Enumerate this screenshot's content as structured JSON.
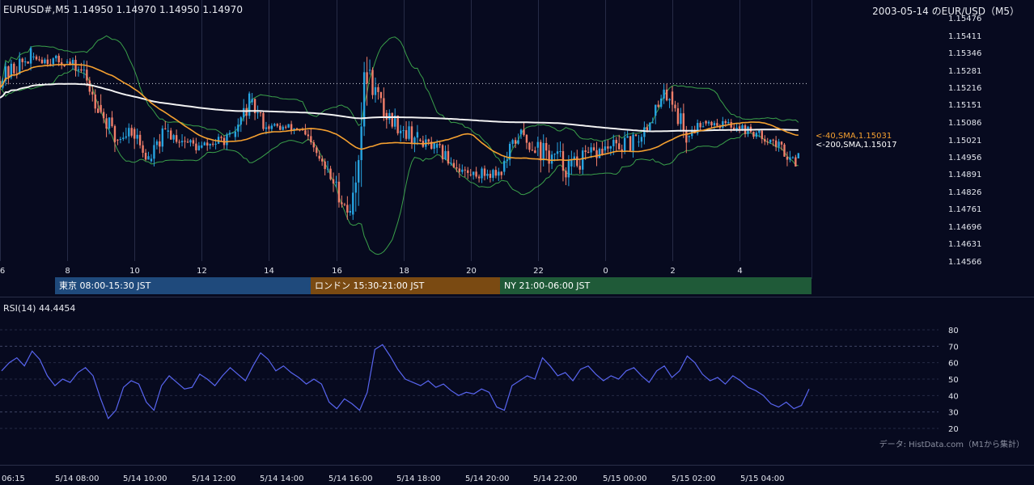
{
  "header": {
    "ohlc_text": "EURUSD#,M5 1.14950 1.14970 1.14950 1.14970",
    "title_right": "2003-05-14 のEUR/USD（M5）"
  },
  "colors": {
    "background": "#070a1f",
    "bullish": "#27a3e0",
    "bearish": "#f07e6a",
    "sma40": "#f5a030",
    "sma200": "#f2f2f2",
    "bollinger": "#3aa04a",
    "rsi": "#5865f0",
    "tokyo_session": "#1f4a7c",
    "london_session": "#7a4a12",
    "ny_session": "#1f5a38"
  },
  "sessions": [
    {
      "label": "東京 08:00-15:30 JST",
      "color": "#1f4a7c"
    },
    {
      "label": "ロンドン 15:30-21:00 JST",
      "color": "#7a4a12"
    },
    {
      "label": "NY 21:00-06:00 JST",
      "color": "#1f5a38"
    }
  ],
  "rsi_label": "RSI(14) 44.4454",
  "source_note": "データ: HistData.com（M1から集計）",
  "chart_data": [
    {
      "type": "candlestick",
      "symbol": "EURUSD#",
      "timeframe": "M5",
      "y_ticks": [
        "1.15476",
        "1.15411",
        "1.15346",
        "1.15281",
        "1.15216",
        "1.15151",
        "1.15086",
        "1.15021",
        "1.14956",
        "1.14891",
        "1.14826",
        "1.14761",
        "1.14696",
        "1.14631",
        "1.14566"
      ],
      "ylim": [
        1.14566,
        1.15476
      ],
      "x_ticks": [
        "6",
        "8",
        "10",
        "12",
        "14",
        "16",
        "18",
        "20",
        "22",
        "0",
        "2",
        "4"
      ],
      "x_range_hours": [
        6.0,
        5.75
      ],
      "grid": true,
      "reference_level": 1.1523,
      "overlays": [
        {
          "name": "40,SMA",
          "label": "<-40,SMA,1.15031",
          "last": 1.15031
        },
        {
          "name": "200,SMA",
          "label": "<-200,SMA,1.15017",
          "last": 1.15017
        }
      ],
      "candles_approx": [
        {
          "t": "06:00",
          "o": 1.1524,
          "h": 1.1537,
          "l": 1.1518,
          "c": 1.1533
        },
        {
          "t": "07:00",
          "o": 1.1533,
          "h": 1.1539,
          "l": 1.1528,
          "c": 1.1531
        },
        {
          "t": "08:00",
          "o": 1.1531,
          "h": 1.1537,
          "l": 1.1523,
          "c": 1.1528
        },
        {
          "t": "08:30",
          "o": 1.1528,
          "h": 1.1535,
          "l": 1.1512,
          "c": 1.1515
        },
        {
          "t": "09:00",
          "o": 1.1515,
          "h": 1.1519,
          "l": 1.1493,
          "c": 1.1502
        },
        {
          "t": "09:30",
          "o": 1.1502,
          "h": 1.151,
          "l": 1.1491,
          "c": 1.1506
        },
        {
          "t": "10:00",
          "o": 1.1506,
          "h": 1.1511,
          "l": 1.1488,
          "c": 1.1494
        },
        {
          "t": "10:30",
          "o": 1.1494,
          "h": 1.151,
          "l": 1.1492,
          "c": 1.1505
        },
        {
          "t": "11:00",
          "o": 1.1505,
          "h": 1.1511,
          "l": 1.1496,
          "c": 1.1499
        },
        {
          "t": "12:00",
          "o": 1.1499,
          "h": 1.1506,
          "l": 1.1494,
          "c": 1.1503
        },
        {
          "t": "13:00",
          "o": 1.1503,
          "h": 1.152,
          "l": 1.15,
          "c": 1.1516
        },
        {
          "t": "13:30",
          "o": 1.1516,
          "h": 1.152,
          "l": 1.1504,
          "c": 1.1507
        },
        {
          "t": "14:00",
          "o": 1.1507,
          "h": 1.1512,
          "l": 1.1502,
          "c": 1.1506
        },
        {
          "t": "15:00",
          "o": 1.1506,
          "h": 1.1509,
          "l": 1.1491,
          "c": 1.1496
        },
        {
          "t": "15:30",
          "o": 1.1496,
          "h": 1.1501,
          "l": 1.1482,
          "c": 1.1486
        },
        {
          "t": "16:00",
          "o": 1.1486,
          "h": 1.149,
          "l": 1.147,
          "c": 1.1474
        },
        {
          "t": "16:30",
          "o": 1.1474,
          "h": 1.1533,
          "l": 1.1472,
          "c": 1.1528
        },
        {
          "t": "17:00",
          "o": 1.1528,
          "h": 1.1535,
          "l": 1.1509,
          "c": 1.1512
        },
        {
          "t": "17:30",
          "o": 1.1512,
          "h": 1.1515,
          "l": 1.1495,
          "c": 1.1502
        },
        {
          "t": "18:30",
          "o": 1.1502,
          "h": 1.1506,
          "l": 1.1495,
          "c": 1.1499
        },
        {
          "t": "19:00",
          "o": 1.1499,
          "h": 1.1502,
          "l": 1.1486,
          "c": 1.1489
        },
        {
          "t": "20:00",
          "o": 1.1489,
          "h": 1.1494,
          "l": 1.1482,
          "c": 1.149
        },
        {
          "t": "21:00",
          "o": 1.149,
          "h": 1.1508,
          "l": 1.1487,
          "c": 1.1504
        },
        {
          "t": "21:30",
          "o": 1.1504,
          "h": 1.1517,
          "l": 1.1497,
          "c": 1.1499
        },
        {
          "t": "22:00",
          "o": 1.1499,
          "h": 1.1504,
          "l": 1.1476,
          "c": 1.1492
        },
        {
          "t": "23:00",
          "o": 1.1492,
          "h": 1.1509,
          "l": 1.1489,
          "c": 1.1498
        },
        {
          "t": "00:00",
          "o": 1.1498,
          "h": 1.1508,
          "l": 1.1489,
          "c": 1.1501
        },
        {
          "t": "01:00",
          "o": 1.1501,
          "h": 1.1513,
          "l": 1.1497,
          "c": 1.1511
        },
        {
          "t": "01:30",
          "o": 1.1511,
          "h": 1.153,
          "l": 1.1505,
          "c": 1.152
        },
        {
          "t": "02:00",
          "o": 1.152,
          "h": 1.1524,
          "l": 1.1497,
          "c": 1.1503
        },
        {
          "t": "02:30",
          "o": 1.1503,
          "h": 1.1512,
          "l": 1.1499,
          "c": 1.1509
        },
        {
          "t": "03:00",
          "o": 1.1509,
          "h": 1.1513,
          "l": 1.1503,
          "c": 1.1507
        },
        {
          "t": "04:00",
          "o": 1.1507,
          "h": 1.151,
          "l": 1.15,
          "c": 1.1502
        },
        {
          "t": "05:00",
          "o": 1.1502,
          "h": 1.1504,
          "l": 1.149,
          "c": 1.1494
        },
        {
          "t": "05:45",
          "o": 1.1495,
          "h": 1.1497,
          "l": 1.1495,
          "c": 1.1497
        }
      ]
    },
    {
      "type": "line",
      "name": "RSI(14)",
      "last": 44.4454,
      "y_ticks": [
        "80",
        "70",
        "60",
        "50",
        "40",
        "30",
        "20"
      ],
      "ylim": [
        20,
        80
      ],
      "levels": [
        30,
        70
      ],
      "x_ticks": [
        "06:15",
        "5/14 08:00",
        "5/14 10:00",
        "5/14 12:00",
        "5/14 14:00",
        "5/14 16:00",
        "5/14 18:00",
        "5/14 20:00",
        "5/14 22:00",
        "5/15 00:00",
        "5/15 02:00",
        "5/15 04:00"
      ],
      "values": [
        55,
        60,
        63,
        58,
        67,
        62,
        52,
        46,
        50,
        48,
        54,
        57,
        52,
        38,
        26,
        31,
        45,
        49,
        47,
        36,
        31,
        46,
        52,
        48,
        44,
        45,
        53,
        50,
        46,
        52,
        57,
        53,
        49,
        58,
        66,
        62,
        55,
        58,
        54,
        51,
        47,
        50,
        47,
        36,
        32,
        38,
        35,
        31,
        42,
        68,
        71,
        64,
        56,
        50,
        48,
        46,
        49,
        45,
        47,
        43,
        40,
        42,
        41,
        44,
        42,
        33,
        31,
        46,
        49,
        52,
        50,
        63,
        58,
        52,
        54,
        49,
        56,
        58,
        53,
        49,
        52,
        50,
        55,
        57,
        52,
        48,
        55,
        58,
        51,
        55,
        64,
        60,
        53,
        49,
        51,
        47,
        52,
        49,
        45,
        43,
        40,
        35,
        33,
        36,
        32,
        34,
        44
      ]
    }
  ]
}
